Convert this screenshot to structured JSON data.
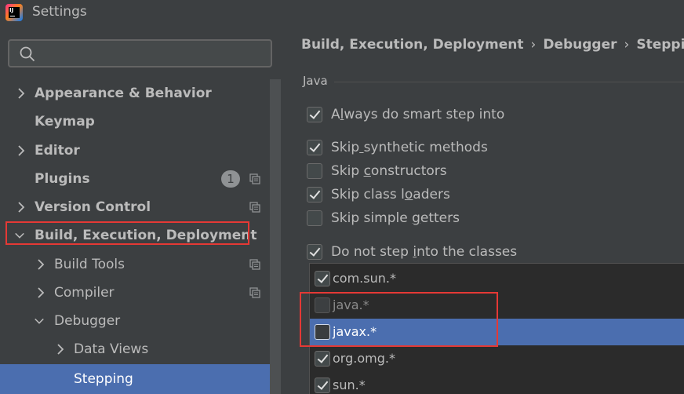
{
  "window": {
    "title": "Settings",
    "app_icon_text": "IJ"
  },
  "search": {
    "placeholder": ""
  },
  "sidebar": {
    "items": [
      {
        "label": "Appearance & Behavior"
      },
      {
        "label": "Keymap"
      },
      {
        "label": "Editor"
      },
      {
        "label": "Plugins",
        "badge": "1"
      },
      {
        "label": "Version Control"
      },
      {
        "label": "Build, Execution, Deployment"
      },
      {
        "label": "Build Tools"
      },
      {
        "label": "Compiler"
      },
      {
        "label": "Debugger"
      },
      {
        "label": "Data Views"
      },
      {
        "label": "Stepping"
      }
    ]
  },
  "breadcrumb": {
    "parts": [
      "Build, Execution, Deployment",
      "Debugger",
      "Stepping"
    ],
    "separator": "›"
  },
  "section": {
    "title": "Java"
  },
  "options": [
    {
      "label_pre": "A",
      "label_u": "l",
      "label_post": "ways do smart step into",
      "checked": true
    },
    {
      "label_pre": "Skip",
      "label_u": " ",
      "label_post": "synthetic methods",
      "checked": true
    },
    {
      "label_pre": "Skip ",
      "label_u": "c",
      "label_post": "onstructors",
      "checked": false
    },
    {
      "label_pre": "Skip class l",
      "label_u": "o",
      "label_post": "aders",
      "checked": true
    },
    {
      "label_pre": "Skip simple ",
      "label_u": "g",
      "label_post": "etters",
      "checked": false
    },
    {
      "label_pre": "Do not step ",
      "label_u": "i",
      "label_post": "nto the classes",
      "checked": true
    }
  ],
  "class_filters": [
    {
      "pattern": "com.sun.*",
      "checked": true
    },
    {
      "pattern": "java.*",
      "checked": false
    },
    {
      "pattern": "javax.*",
      "checked": false
    },
    {
      "pattern": "org.omg.*",
      "checked": true
    },
    {
      "pattern": "sun.*",
      "checked": true
    }
  ],
  "colors": {
    "accent_selection": "#4b6eaf",
    "highlight_box": "#e53935",
    "panel_bg": "#3c3f41",
    "text": "#bbbbbb"
  }
}
